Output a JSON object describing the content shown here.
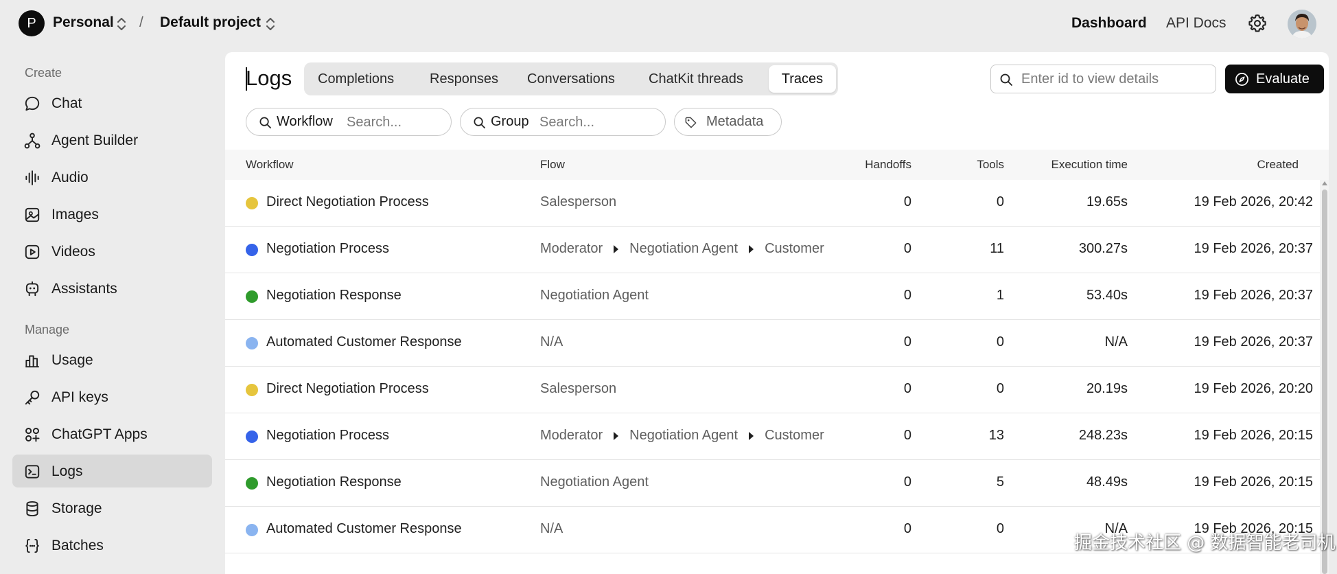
{
  "topbar": {
    "org_initial": "P",
    "org_name": "Personal",
    "separator": "/",
    "project_name": "Default project",
    "links": [
      "Dashboard",
      "API Docs"
    ]
  },
  "sidebar": {
    "sections": [
      {
        "title": "Create",
        "items": [
          {
            "label": "Chat",
            "icon": "chat-bubble-icon"
          },
          {
            "label": "Agent Builder",
            "icon": "agent-graph-icon"
          },
          {
            "label": "Audio",
            "icon": "audio-wave-icon"
          },
          {
            "label": "Images",
            "icon": "image-icon"
          },
          {
            "label": "Videos",
            "icon": "video-play-icon"
          },
          {
            "label": "Assistants",
            "icon": "robot-icon"
          }
        ]
      },
      {
        "title": "Manage",
        "items": [
          {
            "label": "Usage",
            "icon": "bar-chart-icon"
          },
          {
            "label": "API keys",
            "icon": "key-icon"
          },
          {
            "label": "ChatGPT Apps",
            "icon": "apps-icon"
          },
          {
            "label": "Logs",
            "icon": "terminal-icon",
            "active": true
          },
          {
            "label": "Storage",
            "icon": "database-icon"
          },
          {
            "label": "Batches",
            "icon": "braces-icon"
          }
        ]
      }
    ]
  },
  "main": {
    "title": "Logs",
    "tabs": [
      {
        "label": "Completions"
      },
      {
        "label": "Responses"
      },
      {
        "label": "Conversations"
      },
      {
        "label": "ChatKit threads"
      },
      {
        "label": "Traces",
        "active": true
      }
    ],
    "id_search": {
      "placeholder": "Enter id to view details",
      "value": ""
    },
    "evaluate_label": "Evaluate",
    "filters": {
      "workflow": {
        "key": "Workflow",
        "placeholder": "Search..."
      },
      "group": {
        "key": "Group",
        "placeholder": "Search..."
      },
      "metadata": {
        "label": "Metadata"
      }
    }
  },
  "table": {
    "columns": [
      "Workflow",
      "Flow",
      "Handoffs",
      "Tools",
      "Execution time",
      "Created"
    ],
    "rows": [
      {
        "workflow": "Direct Negotiation Process",
        "dot_color": "#e6c53d",
        "flow": [
          "Salesperson"
        ],
        "handoffs": "0",
        "tools": "0",
        "execution_time": "19.65s",
        "created": "19 Feb 2026, 20:42"
      },
      {
        "workflow": "Negotiation Process",
        "dot_color": "#3563e9",
        "flow": [
          "Moderator",
          "Negotiation Agent",
          "Customer"
        ],
        "handoffs": "0",
        "tools": "11",
        "execution_time": "300.27s",
        "created": "19 Feb 2026, 20:37"
      },
      {
        "workflow": "Negotiation Response",
        "dot_color": "#2f9b2c",
        "flow": [
          "Negotiation Agent"
        ],
        "handoffs": "0",
        "tools": "1",
        "execution_time": "53.40s",
        "created": "19 Feb 2026, 20:37"
      },
      {
        "workflow": "Automated Customer Response",
        "dot_color": "#8ab4f0",
        "flow": [
          "N/A"
        ],
        "handoffs": "0",
        "tools": "0",
        "execution_time": "N/A",
        "created": "19 Feb 2026, 20:37"
      },
      {
        "workflow": "Direct Negotiation Process",
        "dot_color": "#e6c53d",
        "flow": [
          "Salesperson"
        ],
        "handoffs": "0",
        "tools": "0",
        "execution_time": "20.19s",
        "created": "19 Feb 2026, 20:20"
      },
      {
        "workflow": "Negotiation Process",
        "dot_color": "#3563e9",
        "flow": [
          "Moderator",
          "Negotiation Agent",
          "Customer"
        ],
        "handoffs": "0",
        "tools": "13",
        "execution_time": "248.23s",
        "created": "19 Feb 2026, 20:15"
      },
      {
        "workflow": "Negotiation Response",
        "dot_color": "#2f9b2c",
        "flow": [
          "Negotiation Agent"
        ],
        "handoffs": "0",
        "tools": "5",
        "execution_time": "48.49s",
        "created": "19 Feb 2026, 20:15"
      },
      {
        "workflow": "Automated Customer Response",
        "dot_color": "#8ab4f0",
        "flow": [
          "N/A"
        ],
        "handoffs": "0",
        "tools": "0",
        "execution_time": "N/A",
        "created": "19 Feb 2026, 20:15"
      }
    ]
  },
  "watermark": "掘金技术社区 @ 数据智能老司机"
}
